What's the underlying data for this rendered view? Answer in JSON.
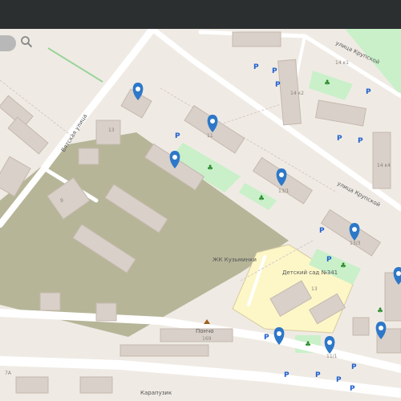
{
  "map": {
    "street_labels": {
      "vyatskaya": "Вятская улица",
      "krupskoy_top": "улица Крупской",
      "krupskoy_mid": "улица Крупской"
    },
    "area_labels": {
      "residential_complex": "ЖК Кузьминки",
      "kindergarten": "Детский сад №341",
      "cafe": "Пончо",
      "cafe_number": "169",
      "shop": "Карапузик"
    },
    "house_numbers": [
      "13",
      "11",
      "13/1",
      "13/3",
      "14 к1",
      "14 к2",
      "14 к4",
      "9",
      "13",
      "11/1",
      "7А"
    ],
    "parking_label": "P",
    "colors": {
      "background": "#efebe4",
      "building": "#d9d0c9",
      "park": "#c9f0c9",
      "pin": "#2d78c8",
      "kindergarten_zone": "#fdf7c8",
      "construction": "#b6b598"
    }
  },
  "pin_icon": "map-pin-icon",
  "search_icon": "magnifier-icon"
}
